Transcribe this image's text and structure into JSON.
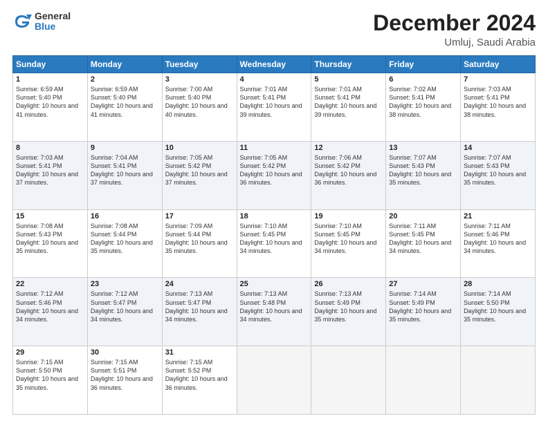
{
  "logo": {
    "general": "General",
    "blue": "Blue"
  },
  "header": {
    "month": "December 2024",
    "location": "Umluj, Saudi Arabia"
  },
  "weekdays": [
    "Sunday",
    "Monday",
    "Tuesday",
    "Wednesday",
    "Thursday",
    "Friday",
    "Saturday"
  ],
  "weeks": [
    [
      {
        "day": "1",
        "sunrise": "6:59 AM",
        "sunset": "5:40 PM",
        "daylight": "10 hours and 41 minutes."
      },
      {
        "day": "2",
        "sunrise": "6:59 AM",
        "sunset": "5:40 PM",
        "daylight": "10 hours and 41 minutes."
      },
      {
        "day": "3",
        "sunrise": "7:00 AM",
        "sunset": "5:40 PM",
        "daylight": "10 hours and 40 minutes."
      },
      {
        "day": "4",
        "sunrise": "7:01 AM",
        "sunset": "5:41 PM",
        "daylight": "10 hours and 39 minutes."
      },
      {
        "day": "5",
        "sunrise": "7:01 AM",
        "sunset": "5:41 PM",
        "daylight": "10 hours and 39 minutes."
      },
      {
        "day": "6",
        "sunrise": "7:02 AM",
        "sunset": "5:41 PM",
        "daylight": "10 hours and 38 minutes."
      },
      {
        "day": "7",
        "sunrise": "7:03 AM",
        "sunset": "5:41 PM",
        "daylight": "10 hours and 38 minutes."
      }
    ],
    [
      {
        "day": "8",
        "sunrise": "7:03 AM",
        "sunset": "5:41 PM",
        "daylight": "10 hours and 37 minutes."
      },
      {
        "day": "9",
        "sunrise": "7:04 AM",
        "sunset": "5:41 PM",
        "daylight": "10 hours and 37 minutes."
      },
      {
        "day": "10",
        "sunrise": "7:05 AM",
        "sunset": "5:42 PM",
        "daylight": "10 hours and 37 minutes."
      },
      {
        "day": "11",
        "sunrise": "7:05 AM",
        "sunset": "5:42 PM",
        "daylight": "10 hours and 36 minutes."
      },
      {
        "day": "12",
        "sunrise": "7:06 AM",
        "sunset": "5:42 PM",
        "daylight": "10 hours and 36 minutes."
      },
      {
        "day": "13",
        "sunrise": "7:07 AM",
        "sunset": "5:43 PM",
        "daylight": "10 hours and 35 minutes."
      },
      {
        "day": "14",
        "sunrise": "7:07 AM",
        "sunset": "5:43 PM",
        "daylight": "10 hours and 35 minutes."
      }
    ],
    [
      {
        "day": "15",
        "sunrise": "7:08 AM",
        "sunset": "5:43 PM",
        "daylight": "10 hours and 35 minutes."
      },
      {
        "day": "16",
        "sunrise": "7:08 AM",
        "sunset": "5:44 PM",
        "daylight": "10 hours and 35 minutes."
      },
      {
        "day": "17",
        "sunrise": "7:09 AM",
        "sunset": "5:44 PM",
        "daylight": "10 hours and 35 minutes."
      },
      {
        "day": "18",
        "sunrise": "7:10 AM",
        "sunset": "5:45 PM",
        "daylight": "10 hours and 34 minutes."
      },
      {
        "day": "19",
        "sunrise": "7:10 AM",
        "sunset": "5:45 PM",
        "daylight": "10 hours and 34 minutes."
      },
      {
        "day": "20",
        "sunrise": "7:11 AM",
        "sunset": "5:45 PM",
        "daylight": "10 hours and 34 minutes."
      },
      {
        "day": "21",
        "sunrise": "7:11 AM",
        "sunset": "5:46 PM",
        "daylight": "10 hours and 34 minutes."
      }
    ],
    [
      {
        "day": "22",
        "sunrise": "7:12 AM",
        "sunset": "5:46 PM",
        "daylight": "10 hours and 34 minutes."
      },
      {
        "day": "23",
        "sunrise": "7:12 AM",
        "sunset": "5:47 PM",
        "daylight": "10 hours and 34 minutes."
      },
      {
        "day": "24",
        "sunrise": "7:13 AM",
        "sunset": "5:47 PM",
        "daylight": "10 hours and 34 minutes."
      },
      {
        "day": "25",
        "sunrise": "7:13 AM",
        "sunset": "5:48 PM",
        "daylight": "10 hours and 34 minutes."
      },
      {
        "day": "26",
        "sunrise": "7:13 AM",
        "sunset": "5:49 PM",
        "daylight": "10 hours and 35 minutes."
      },
      {
        "day": "27",
        "sunrise": "7:14 AM",
        "sunset": "5:49 PM",
        "daylight": "10 hours and 35 minutes."
      },
      {
        "day": "28",
        "sunrise": "7:14 AM",
        "sunset": "5:50 PM",
        "daylight": "10 hours and 35 minutes."
      }
    ],
    [
      {
        "day": "29",
        "sunrise": "7:15 AM",
        "sunset": "5:50 PM",
        "daylight": "10 hours and 35 minutes."
      },
      {
        "day": "30",
        "sunrise": "7:15 AM",
        "sunset": "5:51 PM",
        "daylight": "10 hours and 36 minutes."
      },
      {
        "day": "31",
        "sunrise": "7:15 AM",
        "sunset": "5:52 PM",
        "daylight": "10 hours and 36 minutes."
      },
      null,
      null,
      null,
      null
    ]
  ]
}
